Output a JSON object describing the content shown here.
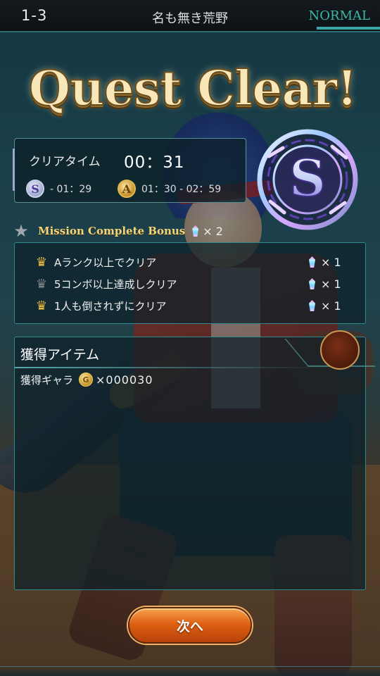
{
  "header": {
    "stage_number": "1-3",
    "stage_name": "名も無き荒野",
    "difficulty": "NORMAL"
  },
  "result": {
    "title": "Quest Clear!",
    "rank": "S"
  },
  "clear_time": {
    "label": "クリアタイム",
    "value": "00：31",
    "rank_s": {
      "letter": "S",
      "range": "- 01：29"
    },
    "rank_a": {
      "letter": "A",
      "range": "01：30 - 02：59"
    }
  },
  "mission": {
    "title": "Mission Complete Bonus",
    "total_reward": "× 2",
    "items": [
      {
        "label": "Aランク以上でクリア",
        "achieved": true,
        "reward": "× 1"
      },
      {
        "label": "5コンボ以上達成しクリア",
        "achieved": false,
        "reward": "× 1"
      },
      {
        "label": "1人も倒されずにクリア",
        "achieved": true,
        "reward": "× 1"
      }
    ]
  },
  "items": {
    "title": "獲得アイテム",
    "gala_label": "獲得ギャラ",
    "gala_amount": "×000030"
  },
  "next_button": {
    "label": "次へ"
  },
  "colors": {
    "accent_teal": "#3bb8a6",
    "gold_text": "#f3d47a",
    "button_orange": "#dd5e11",
    "panel_border": "#2d8a8d"
  },
  "icons": {
    "mission_achieved": "gold-crown-icon",
    "mission_not_achieved": "gray-crown-icon",
    "reward": "rainbow-gem-icon",
    "currency": "gala-coin-icon"
  }
}
